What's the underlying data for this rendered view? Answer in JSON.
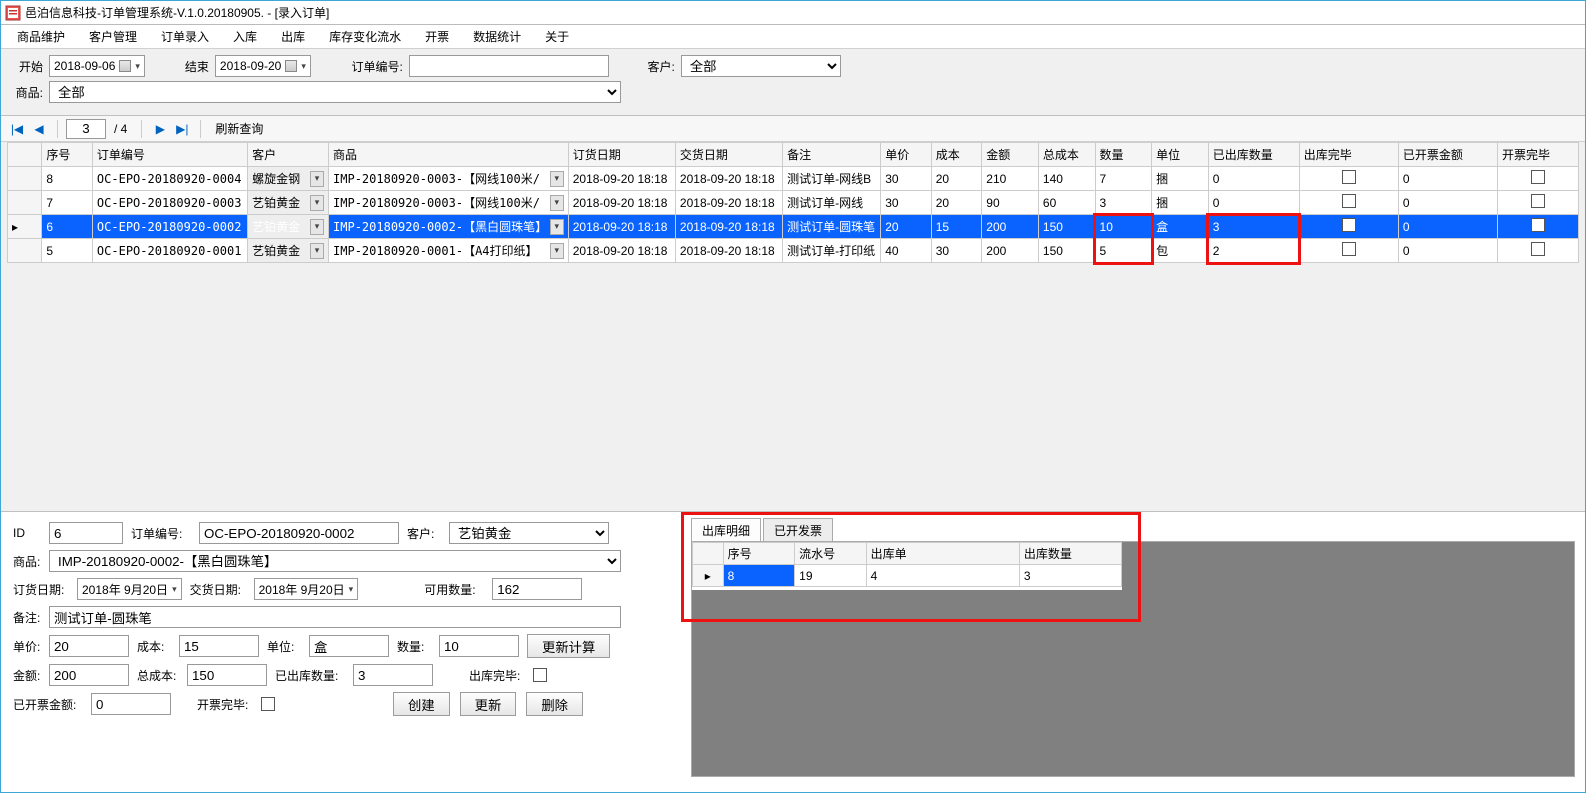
{
  "window": {
    "title": "邑泊信息科技-订单管理系统-V.1.0.20180905. - [录入订单]"
  },
  "menu": [
    "商品维护",
    "客户管理",
    "订单录入",
    "入库",
    "出库",
    "库存变化流水",
    "开票",
    "数据统计",
    "关于"
  ],
  "filters": {
    "start_label": "开始",
    "start_date": "2018-09-06",
    "end_label": "结束",
    "end_date": "2018-09-20",
    "orderNo_label": "订单编号:",
    "orderNo_value": "",
    "customer_label": "客户:",
    "customer_value": "全部",
    "product_label": "商品:",
    "product_value": "全部"
  },
  "nav": {
    "page": "3",
    "total": "/ 4",
    "refresh_label": "刷新查询"
  },
  "grid": {
    "cols": [
      "序号",
      "订单编号",
      "客户",
      "商品",
      "订货日期",
      "交货日期",
      "备注",
      "单价",
      "成本",
      "金额",
      "总成本",
      "数量",
      "单位",
      "已出库数量",
      "出库完毕",
      "已开票金额",
      "开票完毕"
    ],
    "rows": [
      {
        "seq": "8",
        "orderNo": "OC-EPO-20180920-0004",
        "customer": "螺旋金钢",
        "product": "IMP-20180920-0003-【网线100米/",
        "orderDate": "2018-09-20 18:18",
        "delivDate": "2018-09-20 18:18",
        "remark": "测试订单-网线B",
        "price": "30",
        "cost": "20",
        "amount": "210",
        "totalCost": "140",
        "qty": "7",
        "unit": "捆",
        "outQty": "0",
        "outDone": false,
        "invAmt": "0",
        "invDone": false
      },
      {
        "seq": "7",
        "orderNo": "OC-EPO-20180920-0003",
        "customer": "艺铂黄金",
        "product": "IMP-20180920-0003-【网线100米/",
        "orderDate": "2018-09-20 18:18",
        "delivDate": "2018-09-20 18:18",
        "remark": "测试订单-网线",
        "price": "30",
        "cost": "20",
        "amount": "90",
        "totalCost": "60",
        "qty": "3",
        "unit": "捆",
        "outQty": "0",
        "outDone": false,
        "invAmt": "0",
        "invDone": false
      },
      {
        "seq": "6",
        "orderNo": "OC-EPO-20180920-0002",
        "customer": "艺铂黄金",
        "product": "IMP-20180920-0002-【黑白圆珠笔】",
        "orderDate": "2018-09-20 18:18",
        "delivDate": "2018-09-20 18:18",
        "remark": "测试订单-圆珠笔",
        "price": "20",
        "cost": "15",
        "amount": "200",
        "totalCost": "150",
        "qty": "10",
        "unit": "盒",
        "outQty": "3",
        "outDone": false,
        "invAmt": "0",
        "invDone": false,
        "selected": true
      },
      {
        "seq": "5",
        "orderNo": "OC-EPO-20180920-0001",
        "customer": "艺铂黄金",
        "product": "IMP-20180920-0001-【A4打印纸】",
        "orderDate": "2018-09-20 18:18",
        "delivDate": "2018-09-20 18:18",
        "remark": "测试订单-打印纸",
        "price": "40",
        "cost": "30",
        "amount": "200",
        "totalCost": "150",
        "qty": "5",
        "unit": "包",
        "outQty": "2",
        "outDone": false,
        "invAmt": "0",
        "invDone": false
      }
    ]
  },
  "detail": {
    "id_label": "ID",
    "id": "6",
    "orderNo_label": "订单编号:",
    "orderNo": "OC-EPO-20180920-0002",
    "customer_label": "客户:",
    "customer": "艺铂黄金",
    "product_label": "商品:",
    "product": "IMP-20180920-0002-【黑白圆珠笔】",
    "orderDate_label": "订货日期:",
    "orderDate": "2018年 9月20日",
    "delivDate_label": "交货日期:",
    "delivDate": "2018年 9月20日",
    "availQty_label": "可用数量:",
    "availQty": "162",
    "remark_label": "备注:",
    "remark": "测试订单-圆珠笔",
    "price_label": "单价:",
    "price": "20",
    "cost_label": "成本:",
    "cost": "15",
    "unit_label": "单位:",
    "unit": "盒",
    "qty_label": "数量:",
    "qty": "10",
    "recalc_label": "更新计算",
    "amount_label": "金额:",
    "amount": "200",
    "totalCost_label": "总成本:",
    "totalCost": "150",
    "outQty_label": "已出库数量:",
    "outQty": "3",
    "outDone_label": "出库完毕:",
    "invAmt_label": "已开票金额:",
    "invAmt": "0",
    "invDone_label": "开票完毕:",
    "btn_create": "创建",
    "btn_update": "更新",
    "btn_delete": "删除"
  },
  "tabs": {
    "tab1": "出库明细",
    "tab2": "已开发票"
  },
  "subgrid": {
    "cols": [
      "序号",
      "流水号",
      "出库单",
      "出库数量"
    ],
    "row": {
      "seq": "8",
      "flow": "19",
      "outNo": "4",
      "outQty": "3"
    }
  }
}
